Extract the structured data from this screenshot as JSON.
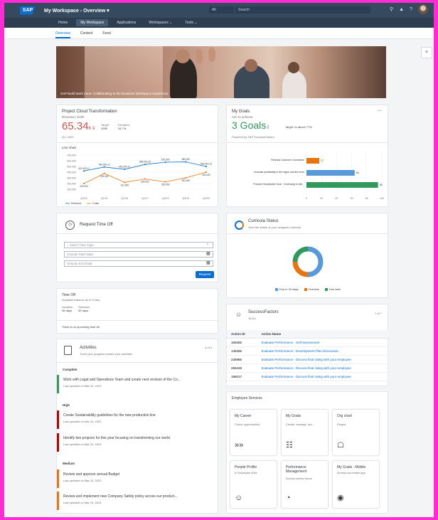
{
  "shell": {
    "logo": "SAP",
    "title": "My Workspace - Overview ▾",
    "scope": "All",
    "search_placeholder": "Search"
  },
  "nav": [
    "Home",
    "My Workspace",
    "Applications",
    "Workspaces ⌄",
    "Tools ⌄"
  ],
  "subtabs": [
    "Overview",
    "Content",
    "Feed"
  ],
  "hero": {
    "caption": "SAP Build Work Zone: Collaborating to the Business Workspace experience"
  },
  "project": {
    "title": "Project Cloud Transformation",
    "subtitle": "Revenue | EUR",
    "kpi": "65.34",
    "kpi_unit": "K",
    "target_label": "Target",
    "target_value": "100K",
    "deviation_label": "Deviation",
    "deviation_value": "34.7%",
    "period": "Q1, 2023",
    "chart_title": "Line chart"
  },
  "chart_data": {
    "type": "line",
    "title": "Line chart",
    "categories": [
      "Q4/15",
      "Q1/16",
      "Q2/16",
      "Q1/17",
      "Q2/19",
      "Q3/19",
      "Q4/20"
    ],
    "ylim": [
      0,
      700000
    ],
    "y_ticks": [
      "700,000",
      "600,000",
      "500,000",
      "400,000",
      "300,000",
      "200,000",
      "100,000"
    ],
    "series": [
      {
        "name": "Revenue",
        "color": "#0a6ed1",
        "values": [
          421000,
          490000,
          451000,
          535000,
          575000,
          580000,
          500000
        ],
        "labels": [
          "421,000.11",
          "490,000.13",
          "451,000.17",
          "535,000.15",
          "575,000",
          "580,000",
          "500,000.13"
        ]
      },
      {
        "name": "Costs",
        "color": "#e9730c",
        "values": [
          200000,
          378000,
          221000,
          280000,
          230000,
          300000,
          400000
        ],
        "labels": [
          "200,000",
          "378,000",
          "221,000",
          "280,000",
          "230,000",
          "300,000",
          "400,000"
        ]
      }
    ],
    "legend": [
      "Revenue",
      "Costs"
    ]
  },
  "goals": {
    "title": "My Goals",
    "subtitle": "Aim to achieve",
    "kpi": "3 Goals",
    "kpi_suffix": "⇩",
    "target": "Target: to above 77%",
    "footer": "Powered by SAP SuccessFactors",
    "bars": [
      {
        "label": "Rebrand Customer Connection",
        "value": 17,
        "color": "#e9730c"
      },
      {
        "label": "Increase profitability in the region and the more",
        "value": 64,
        "color": "#5899da"
      },
      {
        "label": "Promote Sustainable Goal - Continuing to inte...",
        "value": 95,
        "color": "#2f9a5c"
      }
    ],
    "x_ticks": [
      "0",
      "20",
      "40",
      "60",
      "80",
      "100"
    ]
  },
  "timeoff": {
    "title": "Request Time Off",
    "type_placeholder": "-- select Time Type",
    "start_placeholder": "Choose Start Date",
    "end_placeholder": "Choose End Date",
    "button": "Request"
  },
  "timeoff2": {
    "title": "Time Off",
    "subtitle": "Available Balance as of Today",
    "col1_label": "Vacation",
    "col1_value": "36 days",
    "col2_label": "Sickness",
    "col2_value": "39 days",
    "note": "There is no upcoming time off."
  },
  "curricula": {
    "title": "Curricula Status",
    "subtitle": "View the status of your assigned curricula",
    "segments": [
      {
        "label": "Due in 30 days",
        "value": 50,
        "color": "#5899da"
      },
      {
        "label": "Overdue",
        "value": 25,
        "color": "#e9730c"
      },
      {
        "label": "Due later",
        "value": 25,
        "color": "#2f9a5c"
      }
    ]
  },
  "activities": {
    "title": "Activities",
    "subtitle": "Track your progress toward your activities",
    "more": "4 of 4",
    "sections": [
      {
        "name": "Complete",
        "items": [
          {
            "text": "Work with Legal and Operations Team and create next revision of the Co...",
            "date": "Last updated on Mar 24, 2023",
            "color": "#2f9a5c"
          }
        ]
      },
      {
        "name": "High",
        "items": [
          {
            "text": "Create Sustainability guidelines for the new production line",
            "date": "Last updated on Mar 24, 2023",
            "color": "#bb0000"
          },
          {
            "text": "Identify two projects for this year focusing on transforming our world.",
            "date": "Last updated on Mar 24, 2023",
            "color": "#bb0000"
          }
        ]
      },
      {
        "name": "Medium",
        "items": [
          {
            "text": "Review and approve annual Budget",
            "date": "Last updated on Mar 24, 2023",
            "color": "#e9730c"
          },
          {
            "text": "Review and implement new Company Safety policy across our product...",
            "date": "Last updated on Mar 24, 2023",
            "color": "#e9730c"
          }
        ]
      }
    ]
  },
  "successfactors": {
    "title": "SuccessFactors",
    "subtitle": "To-Do",
    "count": "1 of 7",
    "col_id": "Action ID",
    "col_name": "Action Name",
    "rows": [
      {
        "id": "165286",
        "name": "Evaluate Performance - Self-assessment"
      },
      {
        "id": "145286",
        "name": "Evaluate Performance - Development Plan Discussion"
      },
      {
        "id": "236986",
        "name": "Evaluate Performance - Discuss final rating with your employee"
      },
      {
        "id": "265428",
        "name": "Evaluate Performance - Discuss final rating with your employee"
      },
      {
        "id": "186017",
        "name": "Evaluate Performance - Discuss final rating with your employee"
      }
    ]
  },
  "employee": {
    "title": "Employee Services",
    "tiles": [
      {
        "title": "My Career",
        "sub": "Check opportunities",
        "icon": "chevrons-right-icon",
        "glyph": "»»"
      },
      {
        "title": "My Goals",
        "sub": "Create, manage, sco...",
        "icon": "clipboard-icon",
        "glyph": "☷"
      },
      {
        "title": "Org chart",
        "sub": "People",
        "icon": "org-chart-icon",
        "glyph": "☖"
      },
      {
        "title": "People Profile",
        "sub": "In Employee Role",
        "icon": "people-icon",
        "glyph": "☺"
      },
      {
        "title": "Performance Management",
        "sub": "Access review forms",
        "icon": "gauge-icon",
        "glyph": "◔"
      },
      {
        "title": "My Goals - Mobile",
        "sub": "Access via mobile app",
        "icon": "mobile-goal-icon",
        "glyph": "◉"
      }
    ]
  }
}
